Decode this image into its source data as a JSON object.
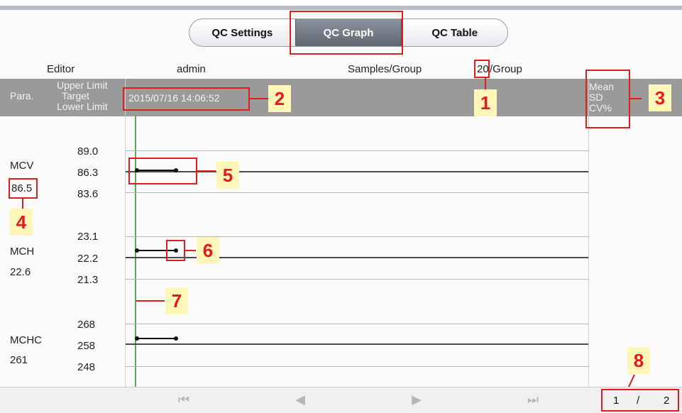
{
  "tabs": [
    {
      "label": "QC Settings",
      "active": false
    },
    {
      "label": "QC Graph",
      "active": true
    },
    {
      "label": "QC Table",
      "active": false
    }
  ],
  "header": {
    "editor_label": "Editor",
    "editor_value": "admin",
    "samples_label": "Samples/Group",
    "samples_value": "20",
    "samples_unit": "/Group"
  },
  "band": {
    "upper": "Upper Limit",
    "para": "Para.",
    "target": "Target",
    "lower": "Lower Limit",
    "timestamp": "2015/07/16 14:06:52",
    "mean": "Mean",
    "sd": "SD",
    "cv": "CV%"
  },
  "params": [
    {
      "name": "MCV",
      "value": "86.5",
      "upper": "89.0",
      "target": "86.3",
      "lower": "83.6"
    },
    {
      "name": "MCH",
      "value": "22.6",
      "upper": "23.1",
      "target": "22.2",
      "lower": "21.3"
    },
    {
      "name": "MCHC",
      "value": "261",
      "upper": "268",
      "target": "258",
      "lower": "248"
    }
  ],
  "nav": {
    "first": "⏮",
    "prev": "◀",
    "next": "▶",
    "last": "⏭"
  },
  "pager": {
    "current": "1",
    "sep": "/",
    "total": "2"
  },
  "callouts": [
    "1",
    "2",
    "3",
    "4",
    "5",
    "6",
    "7",
    "8"
  ],
  "colors": {
    "callout": "#e21b1b",
    "callout_bg": "#fff6b8",
    "cursor_line": "#4caf50",
    "active_tab": "#6b7280"
  }
}
